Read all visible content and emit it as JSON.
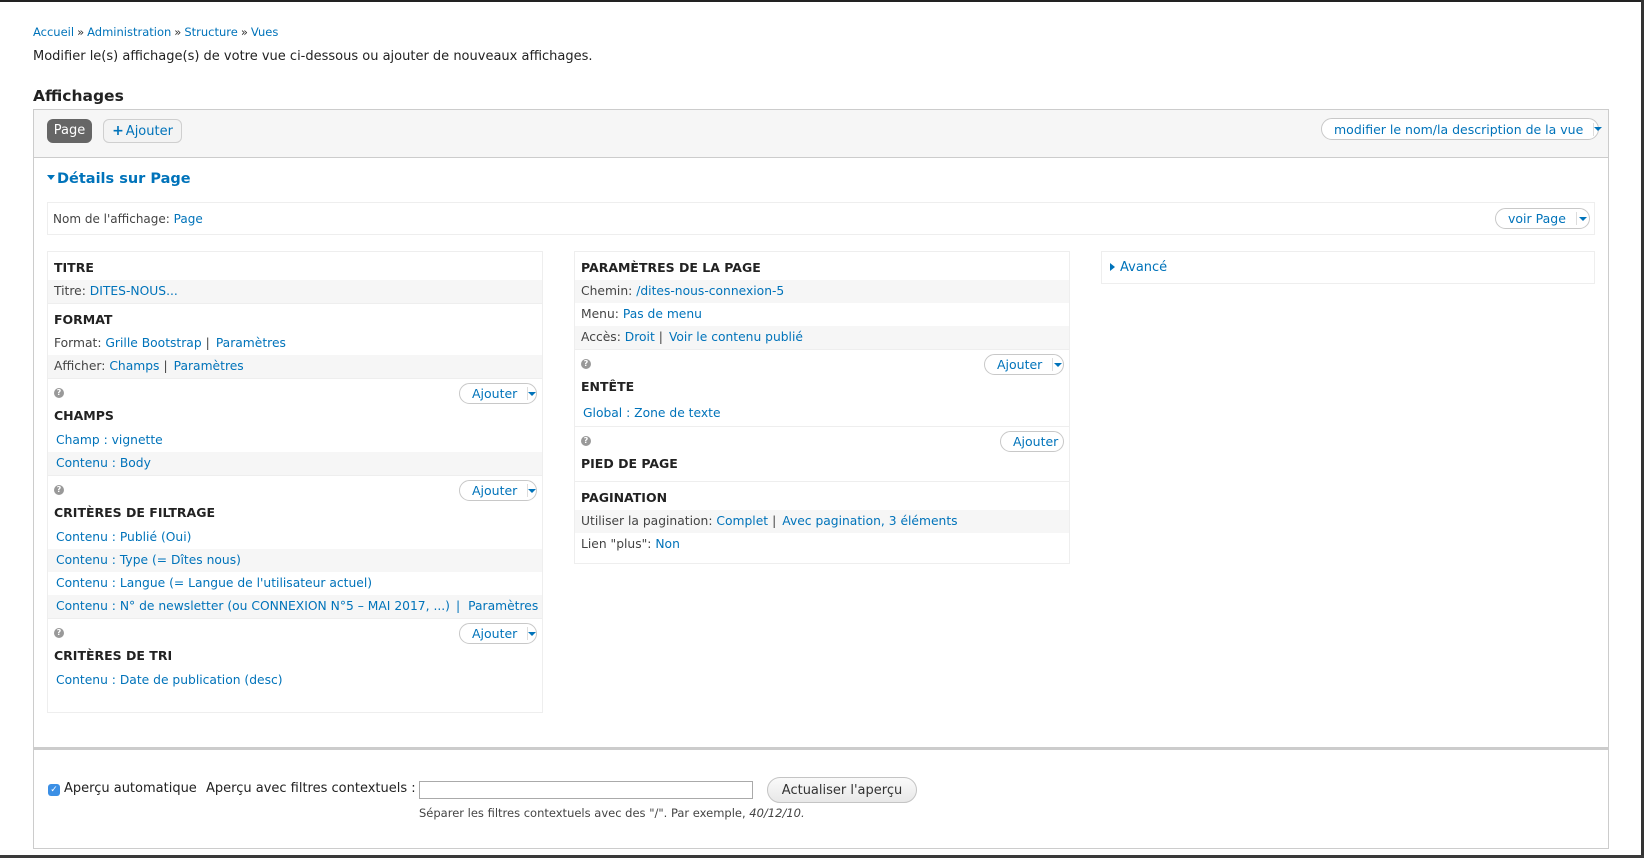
{
  "breadcrumb": [
    {
      "label": "Accueil"
    },
    {
      "label": "Administration"
    },
    {
      "label": "Structure"
    },
    {
      "label": "Vues"
    }
  ],
  "breadcrumb_separator": "»",
  "intro": "Modifier le(s) affichage(s) de votre vue ci-dessous ou ajouter de nouveaux affichages.",
  "section_title": "Affichages",
  "display_tabs": {
    "active": "Page",
    "add_label": "Ajouter",
    "add_icon": "plus-icon"
  },
  "edit_view_button": "modifier le nom/la description de la vue",
  "details_toggle": "Détails sur Page",
  "display_name": {
    "label": "Nom de l'affichage:",
    "value": "Page"
  },
  "view_page_button": "voir Page",
  "add_label": "Ajouter",
  "left_column": {
    "title_section": {
      "title": "TITRE",
      "row": {
        "label": "Titre:",
        "value": "DITES-NOUS..."
      }
    },
    "format_section": {
      "title": "FORMAT",
      "rows": [
        {
          "label": "Format:",
          "value": "Grille Bootstrap",
          "extra": "Paramètres"
        },
        {
          "label": "Afficher:",
          "value": "Champs",
          "extra": "Paramètres"
        }
      ]
    },
    "fields_section": {
      "title": "CHAMPS",
      "items": [
        "Champ : vignette",
        "Contenu : Body"
      ]
    },
    "filters_section": {
      "title": "CRITÈRES DE FILTRAGE",
      "items": [
        "Contenu : Publié (Oui)",
        "Contenu : Type (= Dîtes nous)",
        "Contenu : Langue (= Langue de l'utilisateur actuel)",
        "Contenu : N° de newsletter (ou CONNEXION N°5 – MAI 2017, ...)"
      ],
      "last_item_extra": "Paramètres"
    },
    "sort_section": {
      "title": "CRITÈRES DE TRI",
      "items": [
        "Contenu : Date de publication (desc)"
      ]
    }
  },
  "middle_column": {
    "page_settings": {
      "title": "PARAMÈTRES DE LA PAGE",
      "rows": [
        {
          "label": "Chemin:",
          "value": "/dites-nous-connexion-5"
        },
        {
          "label": "Menu:",
          "value": "Pas de menu"
        },
        {
          "label": "Accès:",
          "value": "Droit",
          "extra": "Voir le contenu publié"
        }
      ]
    },
    "header_section": {
      "title": "ENTÊTE",
      "items": [
        "Global : Zone de texte"
      ]
    },
    "footer_section": {
      "title": "PIED DE PAGE"
    },
    "pager_section": {
      "title": "PAGINATION",
      "rows": [
        {
          "label": "Utiliser la pagination:",
          "value": "Complet",
          "extra": "Avec pagination, 3 éléments"
        },
        {
          "label": "Lien \"plus\":",
          "value": "Non"
        }
      ]
    }
  },
  "advanced_toggle": "Avancé",
  "preview": {
    "auto_preview_label": "Aperçu automatique",
    "auto_preview_checked": true,
    "contextual_label": "Aperçu avec filtres contextuels :",
    "contextual_value": "",
    "refresh_button": "Actualiser l'aperçu",
    "help_text": "Séparer les filtres contextuels avec des \"/\". Par exemple,",
    "help_example": "40/12/10."
  },
  "colors": {
    "link": "#0073ba",
    "active_tab": "#666666",
    "border": "#cccccc"
  }
}
